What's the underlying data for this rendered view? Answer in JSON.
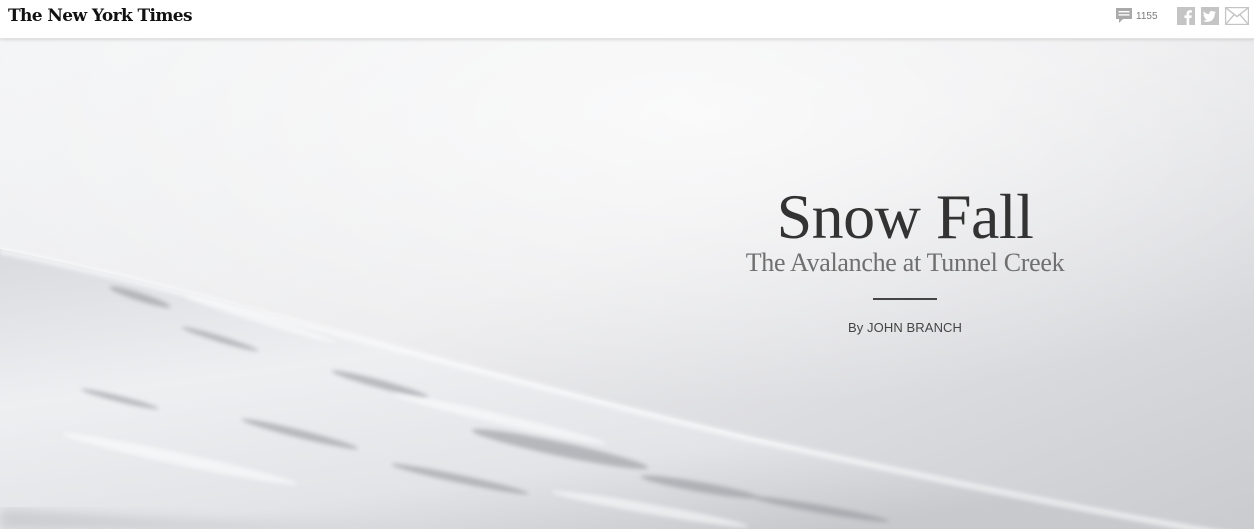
{
  "header": {
    "logo_text": "The New York Times",
    "comment_count": "1155",
    "share": {
      "facebook_icon": "facebook-icon",
      "twitter_icon": "twitter-icon",
      "email_icon": "email-icon"
    }
  },
  "hero": {
    "title": "Snow Fall",
    "subtitle": "The Avalanche at Tunnel Creek",
    "byline": "By JOHN BRANCH"
  },
  "colors": {
    "title": "#333333",
    "subtitle": "#6f6f6f",
    "icon_gray": "#c4c4c4",
    "comment_icon": "#a9a9a9"
  }
}
